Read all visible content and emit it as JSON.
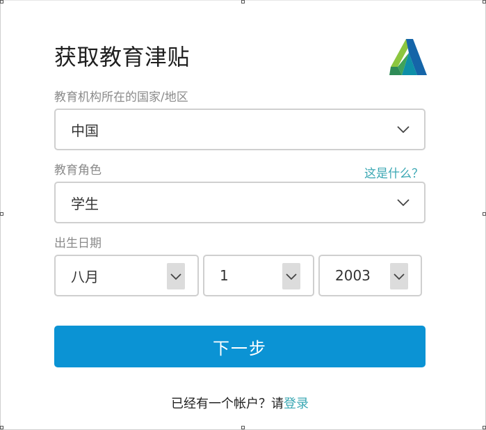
{
  "header": {
    "title": "获取教育津贴",
    "logo_icon": "autodesk-logo-icon"
  },
  "country": {
    "label": "教育机构所在的国家/地区",
    "value": "中国"
  },
  "role": {
    "label": "教育角色",
    "help_link": "这是什么？",
    "value": "学生"
  },
  "birth": {
    "label": "出生日期",
    "month": "八月",
    "day": "1",
    "year": "2003"
  },
  "actions": {
    "next_label": "下一步"
  },
  "footer": {
    "prompt": "已经有一个帐户？请",
    "signin_link": "登录"
  },
  "colors": {
    "primary": "#0b93d4",
    "link": "#3aa7b3",
    "border": "#cfcfcf",
    "label": "#8a8a8a"
  }
}
